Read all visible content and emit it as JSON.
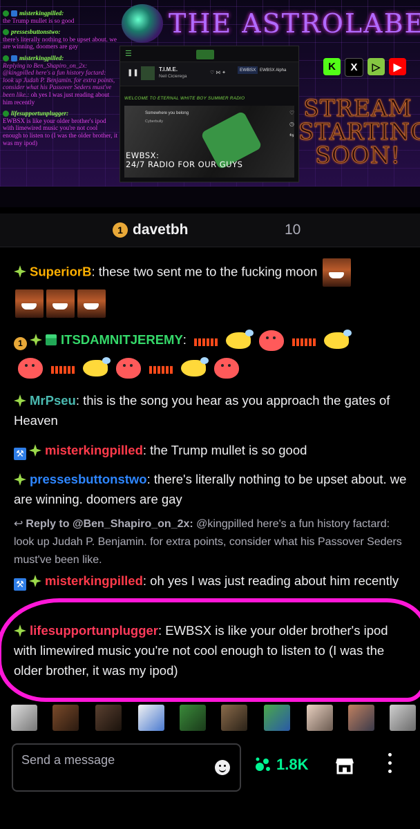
{
  "stream": {
    "title": "THE ASTROLABE",
    "overlay_chat": [
      {
        "user": "misterkingpilled:",
        "text": "the Trump mullet is so good"
      },
      {
        "user": "pressesbuttonstwo:",
        "text": "there's literally nothing to be upset about. we are winning, doomers are gay"
      },
      {
        "user": "misterkingpilled:",
        "reply": "Replying to Ben_Shapiro_on_2x: @kingpilled here's a fun history factard: look up Judah P. Benjamin. for extra points, consider what his Passover Seders must've been like.:",
        "text": "oh yes I was just reading about him recently"
      },
      {
        "user": "lifesupportunplugger:",
        "text": "EWBSX is like your older brother's ipod with limewired music you're not cool enough to listen to (I was the older brother, it was my ipod)"
      }
    ],
    "player": {
      "song": "T.I.M.E.",
      "artist": "Neil Cicierega",
      "station": "EWBSX",
      "station_sub": "EWBSX Alpha",
      "welcome": "WELCOME TO ETERNAL WHITE BOY SUMMER RADIO",
      "card_song": "Somewhere you belong",
      "card_artist": "Cyberbully",
      "caption_1": "EWBSX:",
      "caption_2": "24/7 RADIO FOR OUR GUYS"
    },
    "social": [
      "K",
      "X",
      "▷",
      "▶"
    ],
    "stream_soon": [
      "STREAM",
      "STARTING",
      "SOON!"
    ]
  },
  "channel": {
    "name": "davetbh",
    "rank": "1",
    "count": "10"
  },
  "chat": {
    "messages": [
      {
        "user": "SuperiorB",
        "sep": ": ",
        "text": "these two sent me to the fucking moon"
      },
      {
        "user": "ITSDAMNITJEREMY",
        "sep": ":"
      },
      {
        "user": "MrPseu",
        "sep": ": ",
        "text": "this is the song you hear as you approach the gates of Heaven"
      },
      {
        "user": "misterkingpilled",
        "sep": ": ",
        "text": "the Trump mullet is so good"
      },
      {
        "user": "pressesbuttonstwo",
        "sep": ": ",
        "text": "there's literally nothing to be upset about. we are winning. doomers are gay"
      },
      {
        "user": "misterkingpilled",
        "sep": ": ",
        "text": "oh yes I was just reading about him recently"
      },
      {
        "user": "lifesupportunplugger",
        "sep": ": ",
        "text": "EWBSX is like your older brother's ipod with limewired music you're not cool enough to listen to (I was the older brother, it was my ipod)"
      }
    ],
    "reply": {
      "label": "Reply to @Ben_Shapiro_on_2x:",
      "text": " @kingpilled here's a fun history factard: look up Judah P. Benjamin. for extra points, consider what his Passover Seders must've been like."
    }
  },
  "composer": {
    "placeholder": "Send a message",
    "points": "1.8K"
  },
  "colors": {
    "highlight": "#ff17d8",
    "points": "#00f593",
    "gold_badge": "#e8a838"
  }
}
